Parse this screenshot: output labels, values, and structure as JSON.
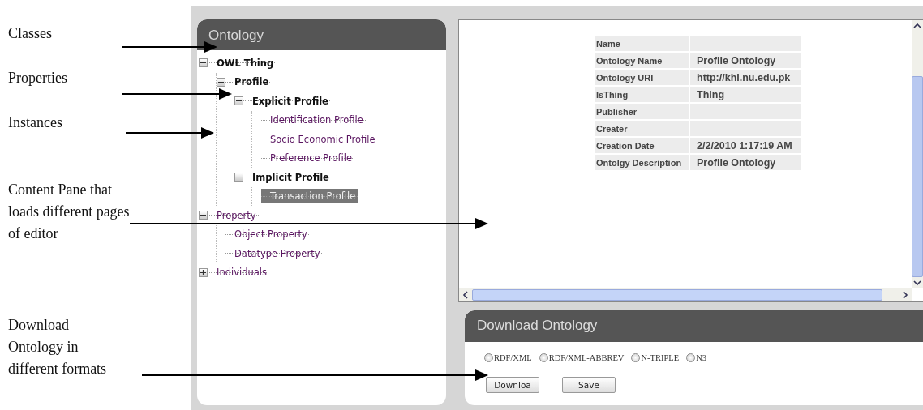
{
  "annotations": [
    {
      "text": "Classes"
    },
    {
      "text": "Properties"
    },
    {
      "text": "Instances"
    },
    {
      "text": "Content Pane that loads different pages of editor"
    },
    {
      "text": "Download Ontology in different formats"
    }
  ],
  "ontology_panel": {
    "title": "Ontology",
    "tree": [
      {
        "label": "OWL Thing",
        "bold": true,
        "expanded": true,
        "selected": false,
        "children": [
          {
            "label": "Profile",
            "bold": true,
            "expanded": true,
            "selected": false,
            "children": [
              {
                "label": "Explicit Profile",
                "bold": true,
                "expanded": true,
                "selected": false,
                "children": [
                  {
                    "label": "Identification Profile",
                    "bold": false,
                    "selected": false
                  },
                  {
                    "label": "Socio Economic Profile",
                    "bold": false,
                    "selected": false
                  },
                  {
                    "label": "Preference Profile",
                    "bold": false,
                    "selected": false
                  }
                ]
              },
              {
                "label": "Implicit Profile",
                "bold": true,
                "expanded": true,
                "selected": false,
                "children": [
                  {
                    "label": "Transaction Profile",
                    "bold": false,
                    "selected": true
                  }
                ]
              }
            ]
          }
        ]
      },
      {
        "label": "Property",
        "bold": false,
        "expanded": true,
        "selected": false,
        "children": [
          {
            "label": "Object Property",
            "bold": false,
            "selected": false
          },
          {
            "label": "Datatype Property",
            "bold": false,
            "selected": false
          }
        ]
      },
      {
        "label": "Individuals",
        "bold": false,
        "expanded": false,
        "selected": false
      }
    ]
  },
  "content_pane": {
    "table": {
      "rows": [
        {
          "label": "Name"
        },
        {
          "label": "Ontology Name",
          "value": "Profile Ontology"
        },
        {
          "label": "Ontology URI",
          "value": "http://khi.nu.edu.pk"
        },
        {
          "label": "IsThing",
          "value": "Thing"
        },
        {
          "label": "Publisher"
        },
        {
          "label": "Creater"
        },
        {
          "label": "Creation Date",
          "value": "2/2/2010 1:17:19 AM"
        },
        {
          "label": "Ontolgy Description",
          "value": "Profile Ontology"
        }
      ]
    }
  },
  "download_panel": {
    "title": "Download Ontology",
    "formats": [
      {
        "label": "RDF/XML",
        "selected": false
      },
      {
        "label": "RDF/XML-ABBREV",
        "selected": false
      },
      {
        "label": "N-TRIPLE",
        "selected": false
      },
      {
        "label": "N3",
        "selected": false
      }
    ],
    "buttons": [
      "Downloa",
      "Save"
    ]
  }
}
